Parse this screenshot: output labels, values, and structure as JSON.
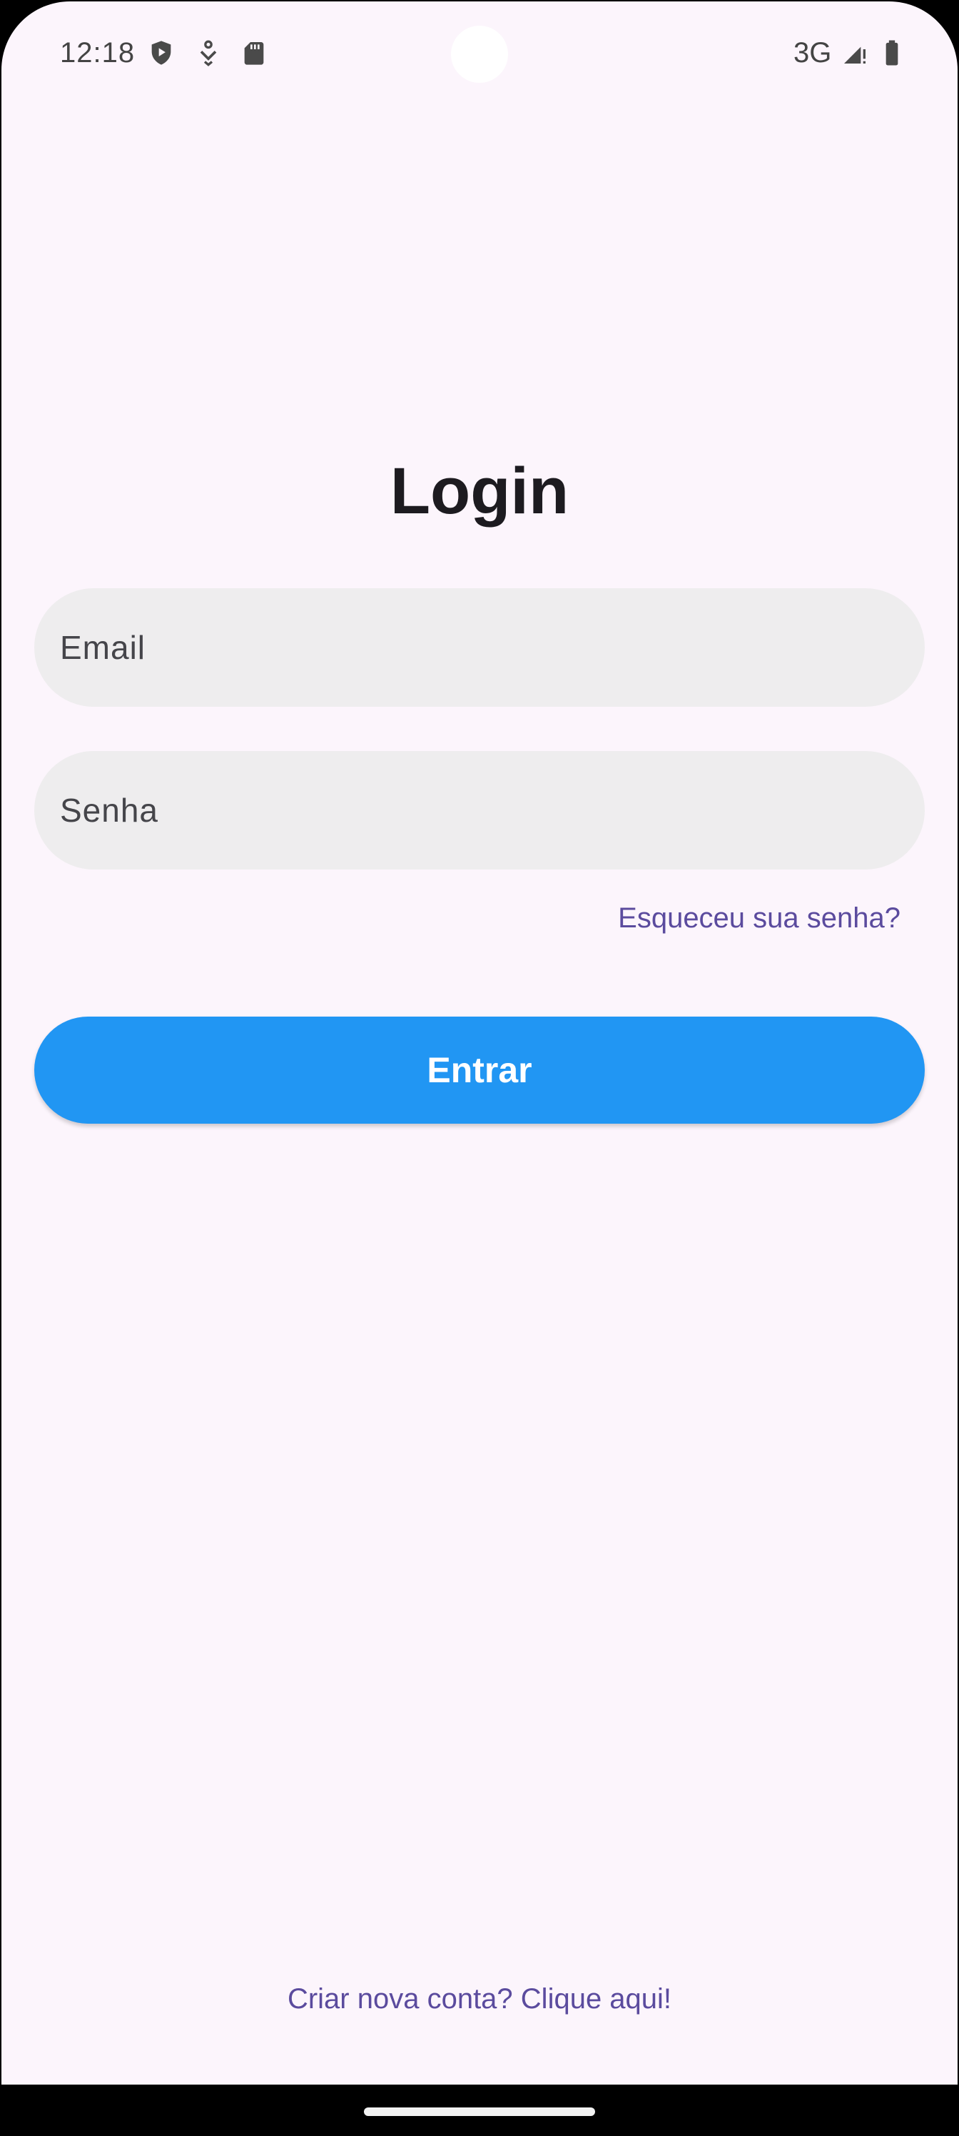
{
  "status_bar": {
    "time": "12:18",
    "icons": [
      "shield-play-icon",
      "download-icon",
      "sd-card-icon"
    ],
    "network": "3G",
    "signal_icon": "cell-signal-icon",
    "battery_icon": "battery-icon"
  },
  "login": {
    "title": "Login",
    "email_placeholder": "Email",
    "password_placeholder": "Senha",
    "forgot_password": "Esqueceu sua senha?",
    "submit_label": "Entrar",
    "signup_link": "Criar nova conta? Clique aqui!"
  },
  "colors": {
    "background": "#FCF5FC",
    "primary_button": "#2196F3",
    "link": "#5B4B9E",
    "input_fill": "#EEEDEE"
  }
}
